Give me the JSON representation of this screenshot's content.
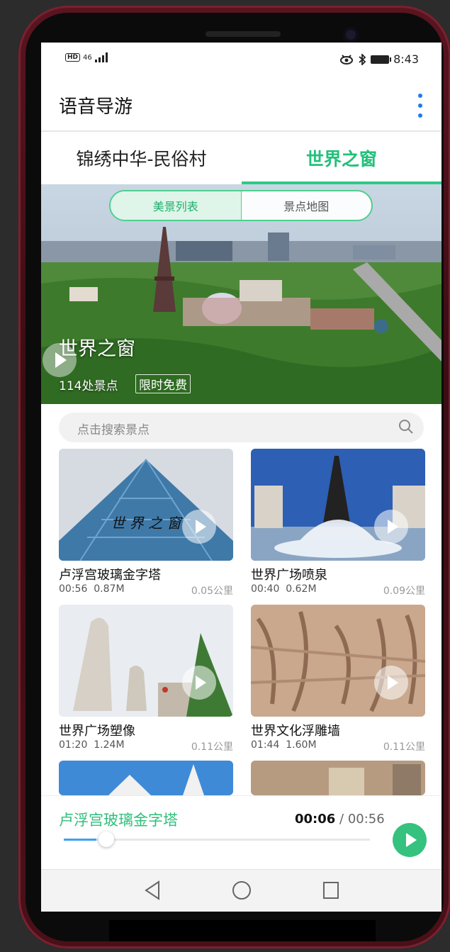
{
  "status_bar": {
    "network": "46",
    "time": "8:43"
  },
  "app_bar": {
    "title": "语音导游"
  },
  "tabs": [
    {
      "label": "锦绣中华-民俗村",
      "active": false
    },
    {
      "label": "世界之窗",
      "active": true
    }
  ],
  "banner": {
    "segment": [
      {
        "label": "美景列表",
        "active": true
      },
      {
        "label": "景点地图",
        "active": false
      }
    ],
    "title": "世界之窗",
    "count": "114处景点",
    "badge": "限时免费"
  },
  "search": {
    "placeholder": "点击搜索景点"
  },
  "spots": [
    {
      "name": "卢浮宫玻璃金字塔",
      "duration": "00:56",
      "size": "0.87M",
      "distance": "0.05公里"
    },
    {
      "name": "世界广场喷泉",
      "duration": "00:40",
      "size": "0.62M",
      "distance": "0.09公里"
    },
    {
      "name": "世界广场塑像",
      "duration": "01:20",
      "size": "1.24M",
      "distance": "0.11公里"
    },
    {
      "name": "世界文化浮雕墙",
      "duration": "01:44",
      "size": "1.60M",
      "distance": "0.11公里"
    }
  ],
  "player": {
    "title": "卢浮宫玻璃金字塔",
    "current": "00:06",
    "separator": " / ",
    "total": "00:56",
    "progress": 0.107
  },
  "colors": {
    "accent_green": "#2ccb86",
    "progress_blue": "#3da0f0",
    "menu_blue": "#1a7cf0"
  }
}
